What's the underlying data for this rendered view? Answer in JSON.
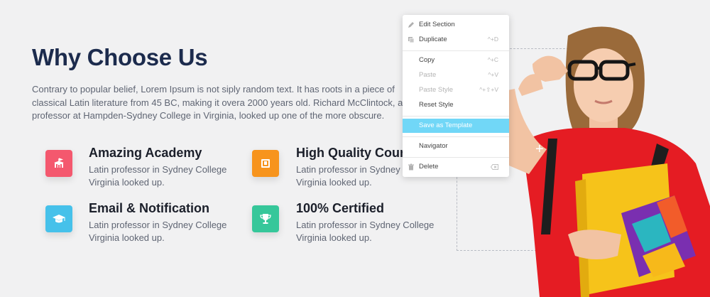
{
  "section": {
    "title": "Why Choose Us",
    "intro": "Contrary to popular belief, Lorem Ipsum is not siply random text. It has roots in a piece of classical Latin literature from 45 BC, making it overa 2000 years old. Richard McClintock, a Latin professor at Hampden-Sydney College in Virginia, looked up one of the more obscure."
  },
  "features": [
    {
      "title": "Amazing Academy",
      "desc": "Latin professor in Sydney College Virginia looked up.",
      "color": "#f4586e",
      "icon": "academy-icon"
    },
    {
      "title": "High Quality Course",
      "desc": "Latin professor in Sydney College Virginia looked up.",
      "color": "#f7941d",
      "icon": "book-icon"
    },
    {
      "title": "Email & Notification",
      "desc": "Latin professor in Sydney College Virginia looked up.",
      "color": "#46c1ea",
      "icon": "graduation-cap-icon"
    },
    {
      "title": "100% Certified",
      "desc": "Latin professor in Sydney College Virginia looked up.",
      "color": "#36c79a",
      "icon": "trophy-icon"
    }
  ],
  "context_menu": {
    "edit_section": "Edit Section",
    "duplicate": "Duplicate",
    "duplicate_shortcut": "^+D",
    "copy": "Copy",
    "copy_shortcut": "^+C",
    "paste": "Paste",
    "paste_shortcut": "^+V",
    "paste_style": "Paste Style",
    "paste_style_shortcut": "^+⇧+V",
    "reset_style": "Reset Style",
    "save_as_template": "Save as Template",
    "navigator": "Navigator",
    "delete": "Delete",
    "highlight_color": "#71d7f7"
  }
}
